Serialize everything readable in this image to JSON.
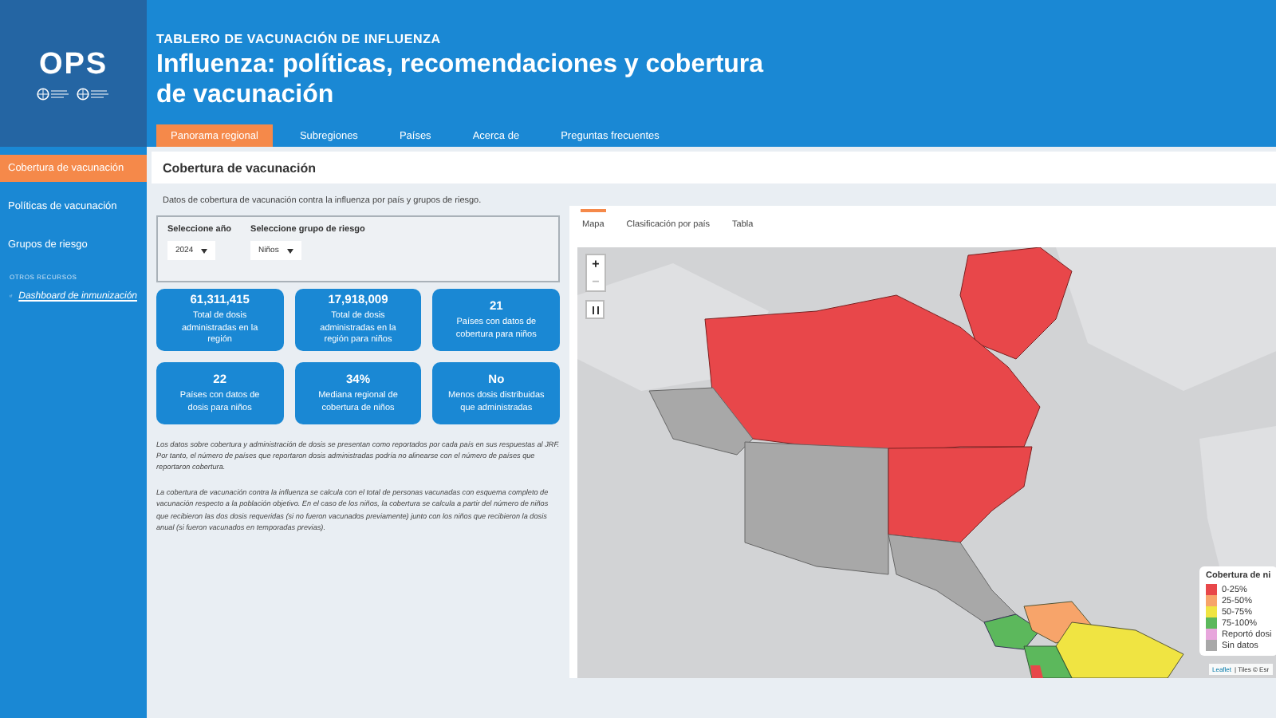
{
  "logo": {
    "name": "OPS"
  },
  "header": {
    "kicker": "TABLERO DE VACUNACIÓN DE INFLUENZA",
    "title": "Influenza: políticas, recomendaciones y cobertura de vacunación"
  },
  "nav_tabs": [
    {
      "label": "Panorama regional",
      "selected": true
    },
    {
      "label": "Subregiones",
      "selected": false
    },
    {
      "label": "Países",
      "selected": false
    },
    {
      "label": "Acerca de",
      "selected": false
    },
    {
      "label": "Preguntas frecuentes",
      "selected": false
    }
  ],
  "sidebar": {
    "items": [
      {
        "label": "Cobertura de vacunación",
        "selected": true
      },
      {
        "label": "Políticas de vacunación",
        "selected": false
      },
      {
        "label": "Grupos de riesgo",
        "selected": false
      }
    ],
    "section_label": "OTROS RECURSOS",
    "link": "Dashboard de inmunización"
  },
  "section": {
    "title": "Cobertura de vacunación",
    "description": "Datos de cobertura de vacunación contra la influenza por país y grupos de riesgo."
  },
  "filters": [
    {
      "label": "Seleccione año",
      "value": "2024"
    },
    {
      "label": "Seleccione grupo de riesgo",
      "value": "Niños"
    }
  ],
  "stats": [
    {
      "value": "61,311,415",
      "label": "Total de dosis administradas en la región"
    },
    {
      "value": "17,918,009",
      "label": "Total de dosis administradas en la región para niños"
    },
    {
      "value": "21",
      "label": "Países con datos de cobertura para niños"
    },
    {
      "value": "22",
      "label": "Países con datos de dosis para niños"
    },
    {
      "value": "34%",
      "label": "Mediana regional de cobertura de niños"
    },
    {
      "value": "No",
      "label": "Menos dosis distribuidas que administradas"
    }
  ],
  "notes": [
    "Los datos sobre cobertura y administración de dosis se presentan como reportados por cada país en sus respuestas al JRF. Por tanto, el número de países que reportaron dosis administradas podría no alinearse con el número de países que reportaron cobertura.",
    "La cobertura de vacunación contra la influenza se calcula con el total de personas vacunadas con esquema completo de vacunación respecto a la población objetivo. En el caso de los niños, la cobertura se calcula a partir del número de niños que recibieron las dos dosis requeridas (si no fueron vacunados previamente) junto con los niños que recibieron la dosis anual (si fueron vacunados en temporadas previas)."
  ],
  "view_tabs": [
    {
      "label": "Mapa",
      "selected": true
    },
    {
      "label": "Clasificación por país",
      "selected": false
    },
    {
      "label": "Tabla",
      "selected": false
    }
  ],
  "map": {
    "zoom_in": "+",
    "zoom_out": "−",
    "legend": {
      "title": "Cobertura de ni",
      "items": [
        {
          "label": "0-25%",
          "color": "#e8474a"
        },
        {
          "label": "25-50%",
          "color": "#f7a46a"
        },
        {
          "label": "50-75%",
          "color": "#f0e442"
        },
        {
          "label": "75-100%",
          "color": "#5cb85c"
        },
        {
          "label": "Reportó dosi",
          "color": "#e7a6dc"
        },
        {
          "label": "Sin datos",
          "color": "#a8a8a8"
        }
      ]
    },
    "attribution_link": "Leaflet",
    "attribution": "| Tiles © Esr"
  }
}
